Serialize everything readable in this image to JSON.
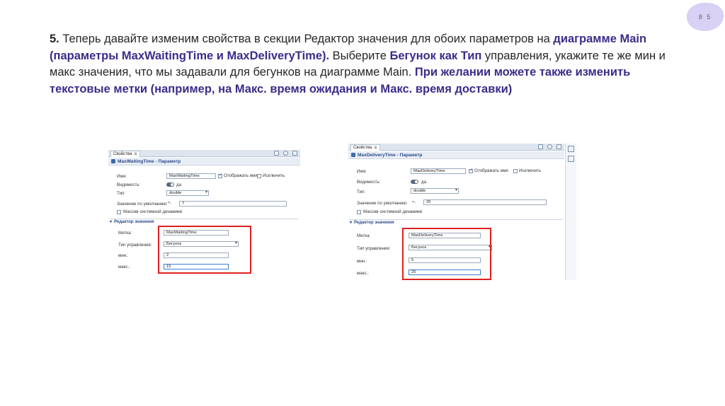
{
  "page_number": "8 5",
  "instruction": {
    "n": "5.",
    "p1": " Теперь давайте изменим свойства в секции Редактор значения для обоих параметров на ",
    "h1": "диаграмме Main (параметры MaxWaitingTime и MaxDeliveryTime).",
    "p2": " Выберите ",
    "h2": "Бегунок как Тип",
    "p3": " управления, укажите те же мин и макс значения, что мы задавали для бегунков на диаграмме Main. ",
    "h3": "При желании можете также изменить текстовые метки (например, на Макс. время ожидания и Макс. время доставки)"
  },
  "panel1": {
    "tab_label": "Свойства",
    "tab_close": "⊠",
    "title": "MaxWaitingTime - Параметр",
    "name_label": "Имя:",
    "name_value": "MaxWaitingTime",
    "show_name_label": "Отображать имя",
    "exclude_label": "Исключить",
    "visibility_label": "Видимость:",
    "visibility_value": "да",
    "type_label": "Тип:",
    "type_value": "double",
    "default_label": "Значение по умолчанию:",
    "eq_icon": "=,",
    "default_value": "7",
    "system_dynamics_label": "Массив системной динамики",
    "section_label": "Редактор значения",
    "mark_label": "Метка:",
    "mark_value": "MaxWaitingTime",
    "control_type_label": "Тип управления:",
    "control_type_value": "Бегунок",
    "min_label": "мин.:",
    "min_value": "2",
    "max_label": "макс.:",
    "max_value": "15"
  },
  "panel2": {
    "tab_label": "Свойства",
    "tab_close": "⊠",
    "title": "MaxDeliveryTime - Параметр",
    "name_label": "Имя:",
    "name_value": "MaxDeliveryTime",
    "show_name_label": "Отображать имя",
    "exclude_label": "Исключить",
    "visibility_label": "Видимость:",
    "visibility_value": "да",
    "type_label": "Тип:",
    "type_value": "double",
    "default_label": "Значение по умолчанию:",
    "eq_icon": "=,",
    "default_value": "25",
    "system_dynamics_label": "Массив системной динамики",
    "section_label": "Редактор значения",
    "mark_label": "Метка:",
    "mark_value": "MaxDeliveryTime",
    "control_type_label": "Тип управления:",
    "control_type_value": "Бегунок",
    "min_label": "мин.:",
    "min_value": "5",
    "max_label": "макс.:",
    "max_value": "25"
  }
}
